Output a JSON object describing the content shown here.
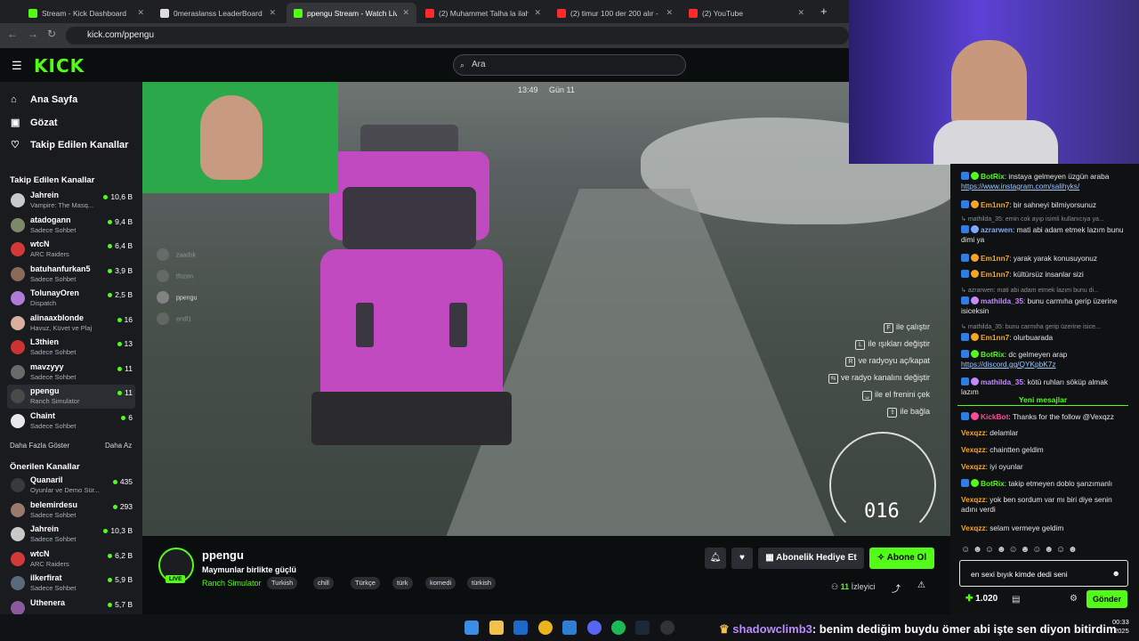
{
  "browser": {
    "tabs": [
      {
        "label": "Stream - Kick Dashboard",
        "color": "#53fc18"
      },
      {
        "label": "0meraslanss LeaderBoard | The",
        "color": "#dddddd"
      },
      {
        "label": "ppengu Stream - Watch Live",
        "color": "#53fc18"
      },
      {
        "label": "(2) Muhammet Talha la ilahe illa",
        "color": "#ff2b2b"
      },
      {
        "label": "(2) timur 100 der 200 alır - You",
        "color": "#ff2b2b"
      },
      {
        "label": "(2) YouTube",
        "color": "#ff2b2b"
      }
    ],
    "url": "kick.com/ppengu",
    "new_tab": "+"
  },
  "header": {
    "logo": "KICK",
    "search_placeholder": "Ara"
  },
  "sidebar": {
    "nav": [
      {
        "label": "Ana Sayfa",
        "icon": "home-icon"
      },
      {
        "label": "Gözat",
        "icon": "browse-icon"
      },
      {
        "label": "Takip Edilen Kanallar",
        "icon": "heart-icon"
      }
    ],
    "followed_title": "Takip Edilen Kanallar",
    "followed": [
      {
        "name": "Jahrein",
        "category": "Vampire: The Masq...",
        "viewers": "10,6 B",
        "color": "#c9c9c9"
      },
      {
        "name": "atadogann",
        "category": "Sadece Sohbet",
        "viewers": "9,4 B",
        "color": "#7d8a6a"
      },
      {
        "name": "wtcN",
        "category": "ARC Raiders",
        "viewers": "6,4 B",
        "color": "#d23a3a"
      },
      {
        "name": "batuhanfurkan5",
        "category": "Sadece Sohbet",
        "viewers": "3,9 B",
        "color": "#8a6a5a"
      },
      {
        "name": "TolunayOren",
        "category": "Dispatch",
        "viewers": "2,5 B",
        "color": "#b07ad8"
      },
      {
        "name": "alinaaxblonde",
        "category": "Havuz, Küvet ve Plaj",
        "viewers": "16",
        "color": "#d8b0a0"
      },
      {
        "name": "L3thien",
        "category": "Sadece Sohbet",
        "viewers": "13",
        "color": "#cc3333"
      },
      {
        "name": "mavzyyy",
        "category": "Sadece Sohbet",
        "viewers": "11",
        "color": "#6a6a6a"
      },
      {
        "name": "ppengu",
        "category": "Ranch Simulator",
        "viewers": "11",
        "color": "#4a4a4a"
      },
      {
        "name": "Chaint",
        "category": "Sadece Sohbet",
        "viewers": "6",
        "color": "#e8e8e8"
      }
    ],
    "show_more": "Daha Fazla Göster",
    "show_less": "Daha Az",
    "recommended_title": "Önerilen Kanallar",
    "recommended": [
      {
        "name": "Quanaril",
        "category": "Oyunlar ve Demo Sür...",
        "viewers": "435",
        "color": "#3a3a3a"
      },
      {
        "name": "belemirdesu",
        "category": "Sadece Sohbet",
        "viewers": "293",
        "color": "#9a7a6a"
      },
      {
        "name": "Jahrein",
        "category": "Sadece Sohbet",
        "viewers": "10,3 B",
        "color": "#c9c9c9"
      },
      {
        "name": "wtcN",
        "category": "ARC Raiders",
        "viewers": "6,2 B",
        "color": "#d23a3a"
      },
      {
        "name": "ilkerfirat",
        "category": "Sadece Sohbet",
        "viewers": "5,9 B",
        "color": "#5a6a7a"
      },
      {
        "name": "Uthenera",
        "category": "",
        "viewers": "5,7 B",
        "color": "#8a5a9a"
      }
    ]
  },
  "game_hud": {
    "time": "13:49",
    "day": "Gün 11",
    "players": [
      "zaadsk",
      "tfozen",
      "ppengu",
      "endl1"
    ],
    "controls": [
      {
        "key": "F",
        "label": "ile çalıştır"
      },
      {
        "key": "L",
        "label": "ile ışıkları değiştir"
      },
      {
        "key": "R",
        "label": "ve radyoyu aç/kapat"
      },
      {
        "key": "⇆",
        "label": "ve radyo kanalını değiştir"
      },
      {
        "key": "␣",
        "label": "ile el frenini çek"
      },
      {
        "key": "⇪",
        "label": "ile bağla"
      }
    ],
    "speed": "016"
  },
  "stream": {
    "name": "ppengu",
    "live_badge": "LIVE",
    "title": "Maymunlar birlikte güçlü",
    "category": "Ranch Simulator",
    "tags": [
      "Turkish",
      "chill",
      "Türkçe",
      "türk",
      "komedi",
      "türkish"
    ],
    "gift_label": "Abonelik Hediye Et",
    "subscribe_label": "Abone Ol",
    "viewer_count": "11",
    "viewer_label": "İzleyici"
  },
  "chat": {
    "messages": [
      {
        "user": "BotRix",
        "color": "#53fc18",
        "text": ": instaya gelmeyen üzgün araba",
        "link": "https://www.instagram.com/salihyks/"
      },
      {
        "user": "Em1nn7",
        "color": "#f6a623",
        "text": ": bir sahneyi bilmiyorsunuz"
      },
      {
        "reply": "mathilda_35: emin cok ayıp isimli kullanıcıya ya..."
      },
      {
        "user": "azrarwen",
        "color": "#7fa7ff",
        "text": ": mati abi adam etmek lazım bunu dimi ya"
      },
      {
        "user": "Em1nn7",
        "color": "#f6a623",
        "text": ": yarak yarak konusuyonuz"
      },
      {
        "user": "Em1nn7",
        "color": "#f6a623",
        "text": ": kültürsüz insanlar sizi"
      },
      {
        "reply": "azrarwen: mati abi adam etmek lazım bunu di..."
      },
      {
        "user": "mathilda_35",
        "color": "#c48bff",
        "text": ": bunu carmıha gerip üzerine isiceksin"
      },
      {
        "reply": "mathilda_35: bunu carmıha gerip üzerine isice..."
      },
      {
        "user": "Em1nn7",
        "color": "#f6a623",
        "text": ": olurbuarada"
      },
      {
        "user": "BotRix",
        "color": "#53fc18",
        "text": ": dc gelmeyen arap",
        "link": "https://discord.gg/QYKpbK7z"
      },
      {
        "user": "mathilda_35",
        "color": "#c48bff",
        "text": ": kötü ruhları söküp almak lazım"
      },
      {
        "user": "KickBot",
        "color": "#ff4a9a",
        "text": ": Thanks for the follow @Vexqzz"
      },
      {
        "user": "Vexqzz",
        "color": "#f6a623",
        "text": ": delamlar"
      },
      {
        "user": "Vexqzz",
        "color": "#f6a623",
        "text": ": chaintten geldim"
      },
      {
        "user": "Vexqzz",
        "color": "#f6a623",
        "text": ": iyi oyunlar"
      },
      {
        "user": "BotRix",
        "color": "#53fc18",
        "text": ": takip etmeyen doblo şanzımanlı"
      },
      {
        "user": "Vexqzz",
        "color": "#f6a623",
        "text": ": yok ben sordum var mı biri diye senin adını verdi"
      },
      {
        "user": "Vexqzz",
        "color": "#f6a623",
        "text": ": selam vermeye geldim"
      }
    ],
    "new_messages": "Yeni mesajlar",
    "input_value": "en sexi bıyık kimde dedi seni",
    "points": "1.020",
    "send_label": "Gönder"
  },
  "taskbar": {
    "ticker_user": "shadowclimb3",
    "ticker_text": ": benim dediğim buydu ömer abi işte sen diyon bitirdim",
    "time": "00:33",
    "date": "2025"
  },
  "colors": {
    "accent": "#53fc18",
    "truck": "#c24ac0"
  }
}
